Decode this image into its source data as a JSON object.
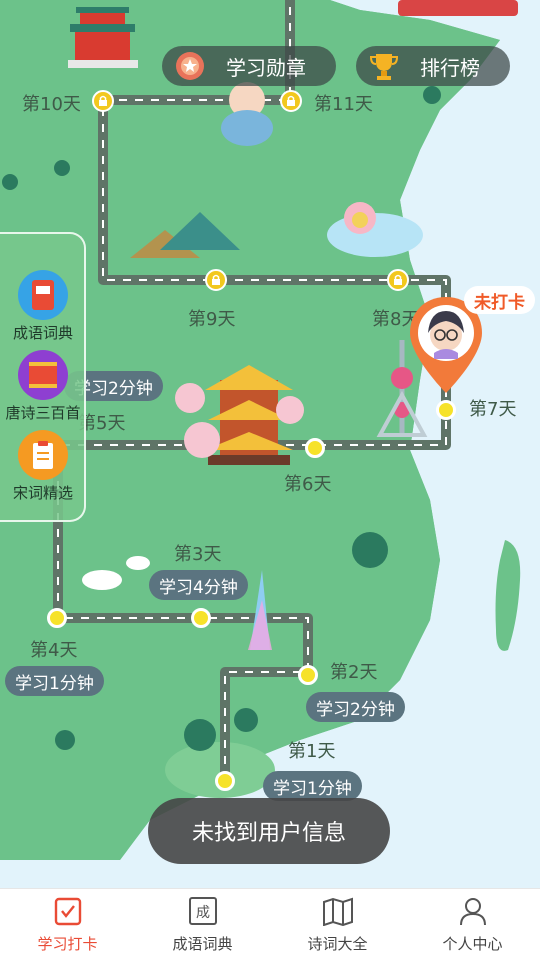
{
  "header": {
    "medal_label": "学习勋章",
    "rank_label": "排行榜"
  },
  "days": [
    {
      "label": "第10天"
    },
    {
      "label": "第11天"
    },
    {
      "label": "第9天"
    },
    {
      "label": "第8天"
    },
    {
      "label": "第7天"
    },
    {
      "label": "第6天"
    },
    {
      "label": "第5天"
    },
    {
      "label": "第4天"
    },
    {
      "label": "第3天"
    },
    {
      "label": "第2天"
    },
    {
      "label": "第1天"
    }
  ],
  "tasks": [
    {
      "label": "学习2分钟"
    },
    {
      "label": "学习4分钟"
    },
    {
      "label": "学习1分钟"
    },
    {
      "label": "学习2分钟"
    },
    {
      "label": "学习1分钟"
    }
  ],
  "side": {
    "items": [
      {
        "label": "成语词典",
        "icon": "idiom-book-icon"
      },
      {
        "label": "唐诗三百首",
        "icon": "tang-poems-icon"
      },
      {
        "label": "宋词精选",
        "icon": "song-ci-icon"
      }
    ]
  },
  "status": {
    "unpunched": "未打卡"
  },
  "toast": {
    "message": "未找到用户信息"
  },
  "tabbar": {
    "items": [
      {
        "label": "学习打卡",
        "icon": "checkin-icon",
        "active": true
      },
      {
        "label": "成语词典",
        "icon": "idiom-icon",
        "active": false
      },
      {
        "label": "诗词大全",
        "icon": "poetry-book-icon",
        "active": false
      },
      {
        "label": "个人中心",
        "icon": "person-icon",
        "active": false
      }
    ]
  },
  "colors": {
    "land": "#6cc28a",
    "water": "#e2f3fb",
    "path": "#5f7467",
    "accent": "#e94b35",
    "pin": "#f27a3a"
  }
}
